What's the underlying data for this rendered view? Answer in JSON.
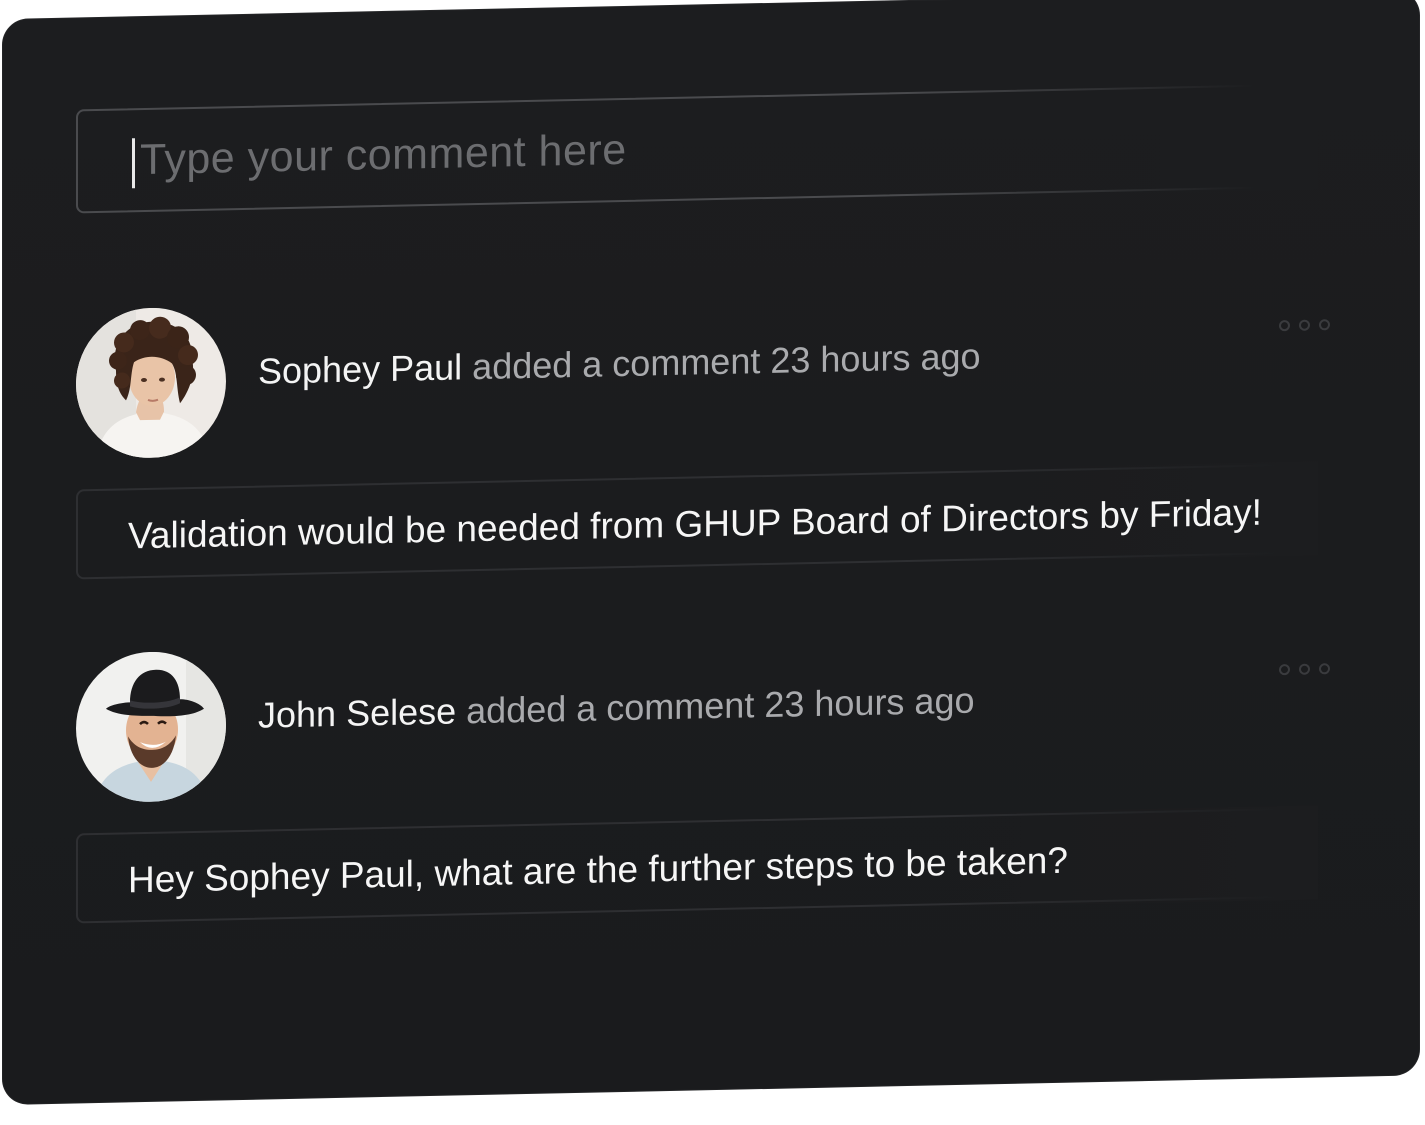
{
  "composer": {
    "placeholder": "Type your comment here"
  },
  "comments": [
    {
      "author": "Sophey Paul",
      "action": "added a comment 23 hours ago",
      "body": "Validation would be needed from GHUP Board of Directors by Friday!",
      "avatar_icon": "woman-curly-hair-avatar"
    },
    {
      "author": "John Selese",
      "action": "added a comment 23 hours ago",
      "body": "Hey Sophey Paul, what are the further steps to be taken?",
      "avatar_icon": "man-black-hat-avatar"
    }
  ],
  "colors": {
    "background": "#1c1d1f",
    "text_primary": "#f4f4f4",
    "text_secondary": "#a9aaad",
    "placeholder": "#6c6d70",
    "border": "#4a4b4e"
  }
}
